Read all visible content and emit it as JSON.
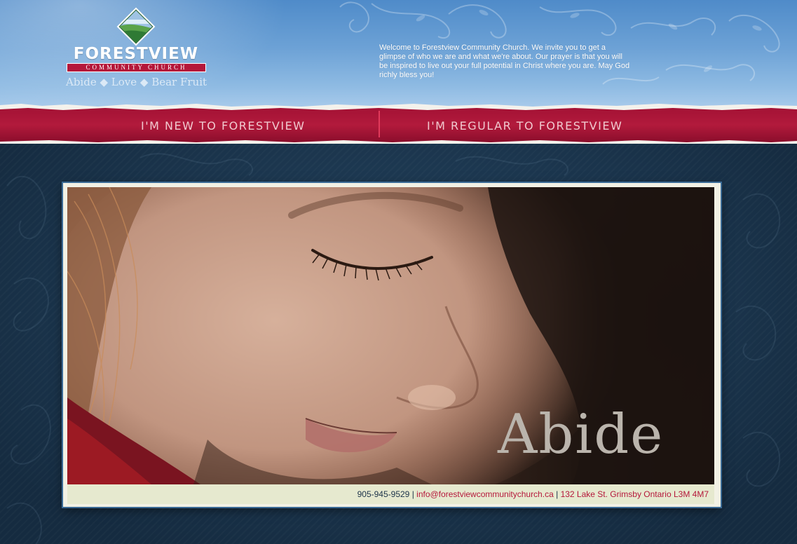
{
  "logo": {
    "name": "FORESTVIEW",
    "subtitle": "COMMUNITY CHURCH",
    "tagline": "Abide ◆ Love ◆ Bear Fruit"
  },
  "header": {
    "welcome_text": "Welcome to Forestview Community Church. We invite you to get a glimpse of who we are and what we're about. Our prayer is that you will be inspired to live out your full potential in Christ where you are. May God richly bless you!"
  },
  "nav": {
    "items": [
      {
        "label": "I'M NEW TO FORESTVIEW"
      },
      {
        "label": "I'M REGULAR TO FORESTVIEW"
      }
    ]
  },
  "hero": {
    "overlay_text": "Abide"
  },
  "contact": {
    "phone": "905-945-9529",
    "separator": "|",
    "email": "info@forestviewcommunitychurch.ca",
    "address": "132 Lake St. Grimsby Ontario L3M 4M7"
  },
  "colors": {
    "brand_red": "#b4173a",
    "header_blue": "#6da2d6",
    "body_navy": "#1c3850",
    "footer_cream": "#e6e9cf"
  },
  "icons": [
    "forestview-logo-icon"
  ]
}
